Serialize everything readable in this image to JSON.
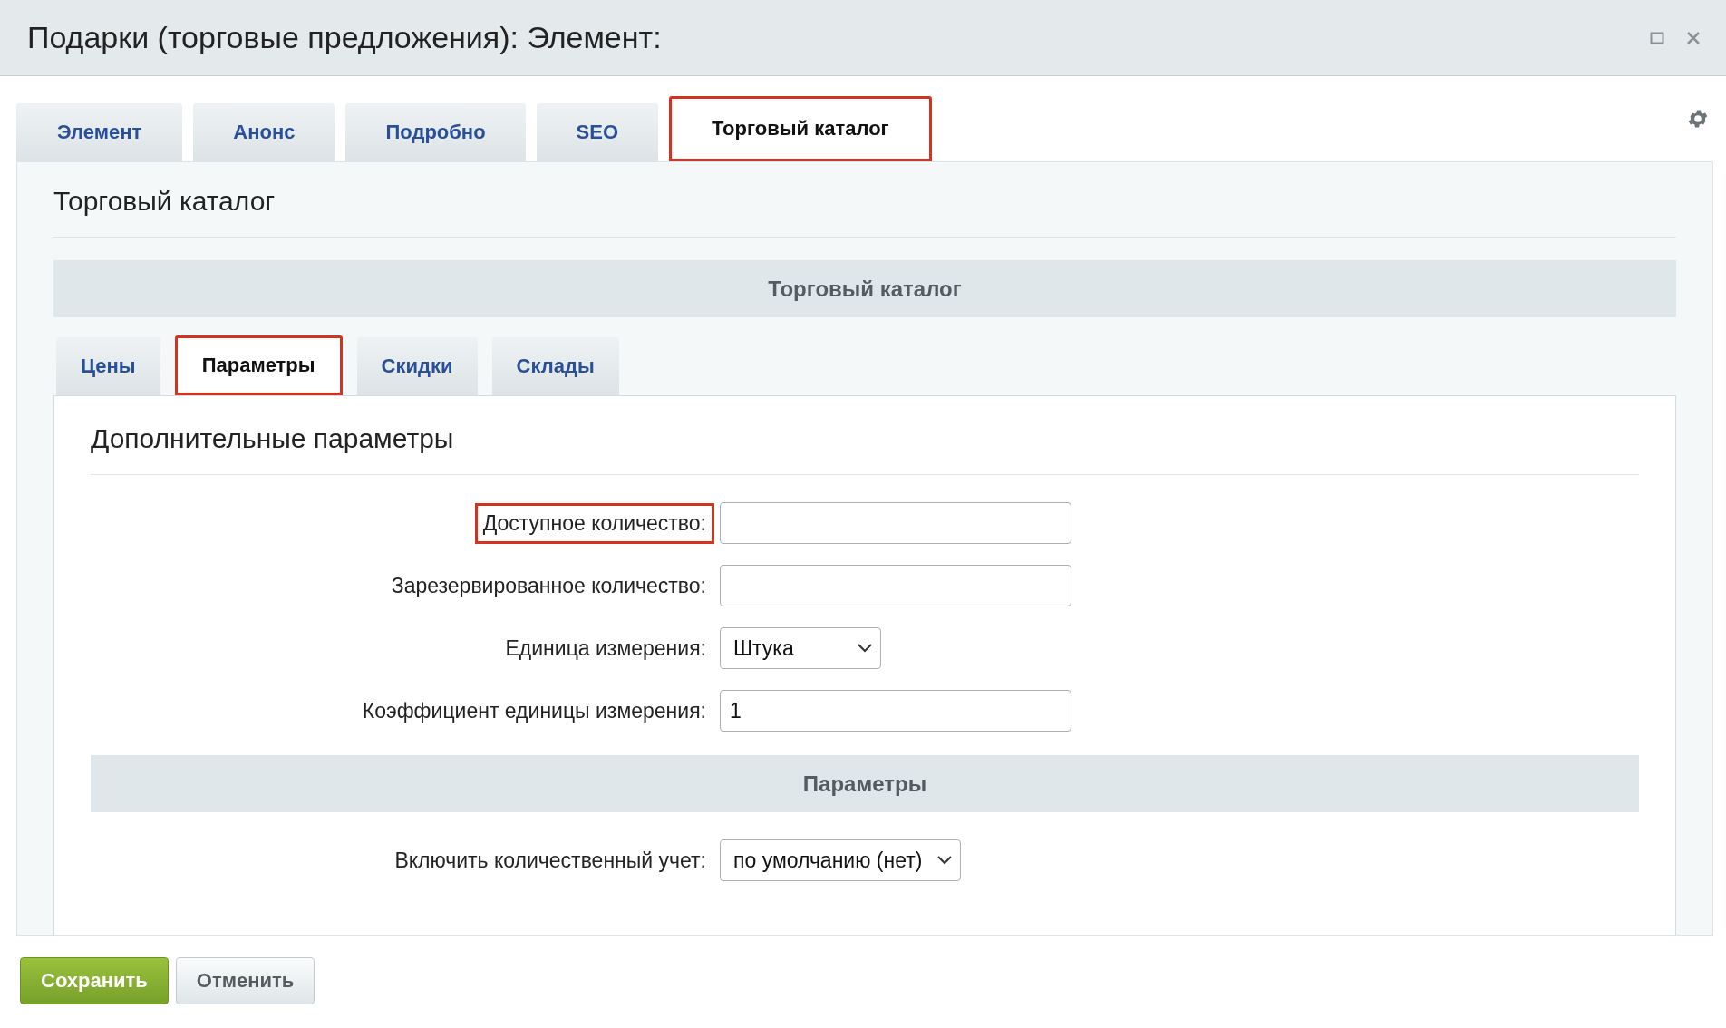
{
  "window": {
    "title": "Подарки (торговые предложения): Элемент:"
  },
  "tabs": [
    {
      "label": "Элемент",
      "selected": false,
      "highlighted": false
    },
    {
      "label": "Анонс",
      "selected": false,
      "highlighted": false
    },
    {
      "label": "Подробно",
      "selected": false,
      "highlighted": false
    },
    {
      "label": "SEO",
      "selected": false,
      "highlighted": false
    },
    {
      "label": "Торговый каталог",
      "selected": true,
      "highlighted": true
    }
  ],
  "page_title": "Торговый каталог",
  "section_header": "Торговый каталог",
  "subtabs": [
    {
      "label": "Цены",
      "selected": false,
      "highlighted": false
    },
    {
      "label": "Параметры",
      "selected": true,
      "highlighted": true
    },
    {
      "label": "Скидки",
      "selected": false,
      "highlighted": false
    },
    {
      "label": "Склады",
      "selected": false,
      "highlighted": false
    }
  ],
  "subsection_title": "Дополнительные параметры",
  "fields": [
    {
      "kind": "text",
      "label": "Доступное количество:",
      "highlighted": true
    },
    {
      "kind": "text",
      "label": "Зарезервированное количество:",
      "highlighted": false
    },
    {
      "kind": "select",
      "label": "Единица измерения:",
      "value": "Штука",
      "highlighted": false
    },
    {
      "kind": "text",
      "label": "Коэффициент единицы измерения:",
      "value": "1",
      "highlighted": false
    }
  ],
  "params_header": "Параметры",
  "params_fields": [
    {
      "kind": "select",
      "label": "Включить количественный учет:",
      "value": "по умолчанию (нет)",
      "highlighted": false
    }
  ],
  "buttons": [
    {
      "kind": "primary",
      "label": "Сохранить"
    },
    {
      "kind": "secondary",
      "label": "Отменить"
    }
  ]
}
